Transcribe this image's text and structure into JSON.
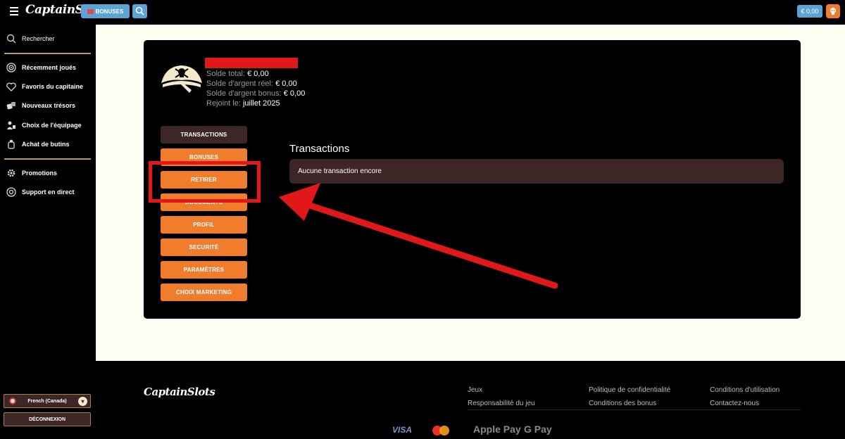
{
  "topbar": {
    "logo": "CaptainSlots",
    "bonus_label": "BONUSES",
    "balance": "€ 0,00"
  },
  "sidebar": {
    "items": [
      {
        "label": "Rechercher",
        "icon": "search-icon"
      },
      {
        "label": "Récemment joués",
        "icon": "target-icon"
      },
      {
        "label": "Favoris du capitaine",
        "icon": "heart-icon"
      },
      {
        "label": "Nouveaux trésors",
        "icon": "dice-icon"
      },
      {
        "label": "Choix de l'équipage",
        "icon": "crew-icon"
      },
      {
        "label": "Achat de butins",
        "icon": "bottle-icon"
      },
      {
        "label": "Promotions",
        "icon": "gear-icon"
      },
      {
        "label": "Support en direct",
        "icon": "lifebuoy-icon"
      }
    ],
    "language": "French (Canada)",
    "logout": "DÉCONNEXION"
  },
  "profile": {
    "total_label": "Solde total:",
    "total_value": "€ 0,00",
    "real_label": "Solde d'argent réel:",
    "real_value": "€ 0,00",
    "bonus_label": "Solde d'argent bonus:",
    "bonus_value": "€ 0,00",
    "joined_label": "Rejoint le:",
    "joined_value": "juillet 2025"
  },
  "menu": {
    "items": [
      {
        "label": "TRANSACTIONS",
        "active": true
      },
      {
        "label": "BONUSES",
        "active": false
      },
      {
        "label": "RETIRER",
        "active": false
      },
      {
        "label": "DOCUMENTS",
        "active": false
      },
      {
        "label": "PROFIL",
        "active": false
      },
      {
        "label": "SECURITÉ",
        "active": false
      },
      {
        "label": "PARAMÈTRES",
        "active": false
      },
      {
        "label": "CHOIX MARKETING",
        "active": false
      }
    ]
  },
  "transactions": {
    "title": "Transactions",
    "empty_message": "Aucune transaction encore"
  },
  "footer": {
    "logo": "CaptainSlots",
    "links": [
      "Jeux",
      "Responsabilité du jeu",
      "Politique de confidentialité",
      "Conditions des bonus",
      "Conditions d'utilisation",
      "Contactez-nous"
    ],
    "payments": [
      "VISA",
      "mastercard",
      "Apple Pay",
      "G Pay"
    ]
  },
  "colors": {
    "accent": "#f07d2c",
    "active_menu": "#3d2626",
    "top_buttons": "#5fa3d4",
    "annotation": "#e0181a"
  }
}
